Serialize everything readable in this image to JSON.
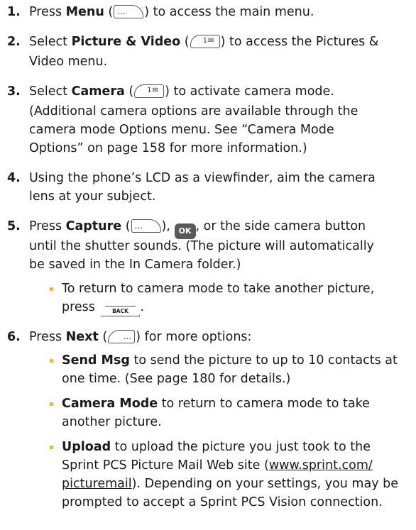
{
  "steps": [
    {
      "num": "1.",
      "pre": "Press ",
      "bold": "Menu",
      "post": " to access the main menu.",
      "key": "menu"
    },
    {
      "num": "2.",
      "pre": "Select ",
      "bold": "Picture & Video",
      "post": " to access the Pictures &",
      "post2": "Video menu.",
      "key": "pic"
    },
    {
      "num": "3.",
      "pre": "Select ",
      "bold": "Camera",
      "post": " to activate camera mode.",
      "key": "pic",
      "extra": [
        "(Additional camera options are available through the",
        "camera mode Options menu. See “Camera Mode",
        "Options” on page 158 for more information.)"
      ]
    },
    {
      "num": "4.",
      "l1": "Using the phone’s LCD as a viewfinder, aim the camera",
      "l2": "lens at your subject."
    },
    {
      "num": "5.",
      "pre": "Press ",
      "bold": "Capture",
      "mid": ", ",
      "post": ", or the side camera button",
      "l2": "until the shutter sounds. (The picture will automatically",
      "l3": "be saved in the In Camera folder.)",
      "sub": {
        "l1": "To return to camera mode to take another picture,",
        "l2": "press ",
        "l2_end": "."
      }
    },
    {
      "num": "6.",
      "pre": "Press ",
      "bold": "Next",
      "post": " for more options:",
      "key": "next",
      "subs": [
        {
          "bold": "Send Msg",
          "text": " to send the picture to up to 10 contacts at",
          "l2": "one time. (See page 180 for details.)"
        },
        {
          "bold": "Camera Mode",
          "text": " to return to camera mode to take",
          "l2": "another picture."
        },
        {
          "bold": "Upload",
          "text": " to upload the picture you just took to the",
          "l2_pre": "Sprint PCS Picture Mail Web site (",
          "l2_link": "www.sprint.com/",
          "l3_link": "picturemail",
          "l3_post": "). Depending on your settings, you may be",
          "l4": "prompted to accept a Sprint PCS Vision connection."
        }
      ]
    }
  ],
  "keys": {
    "menu_dots": "...",
    "pic_label": "1✉",
    "next_dots": "...",
    "ok_label": "OK",
    "back_label": "BACK"
  },
  "colors": {
    "bullet": "#f2b233",
    "text": "#1a1a1a"
  }
}
